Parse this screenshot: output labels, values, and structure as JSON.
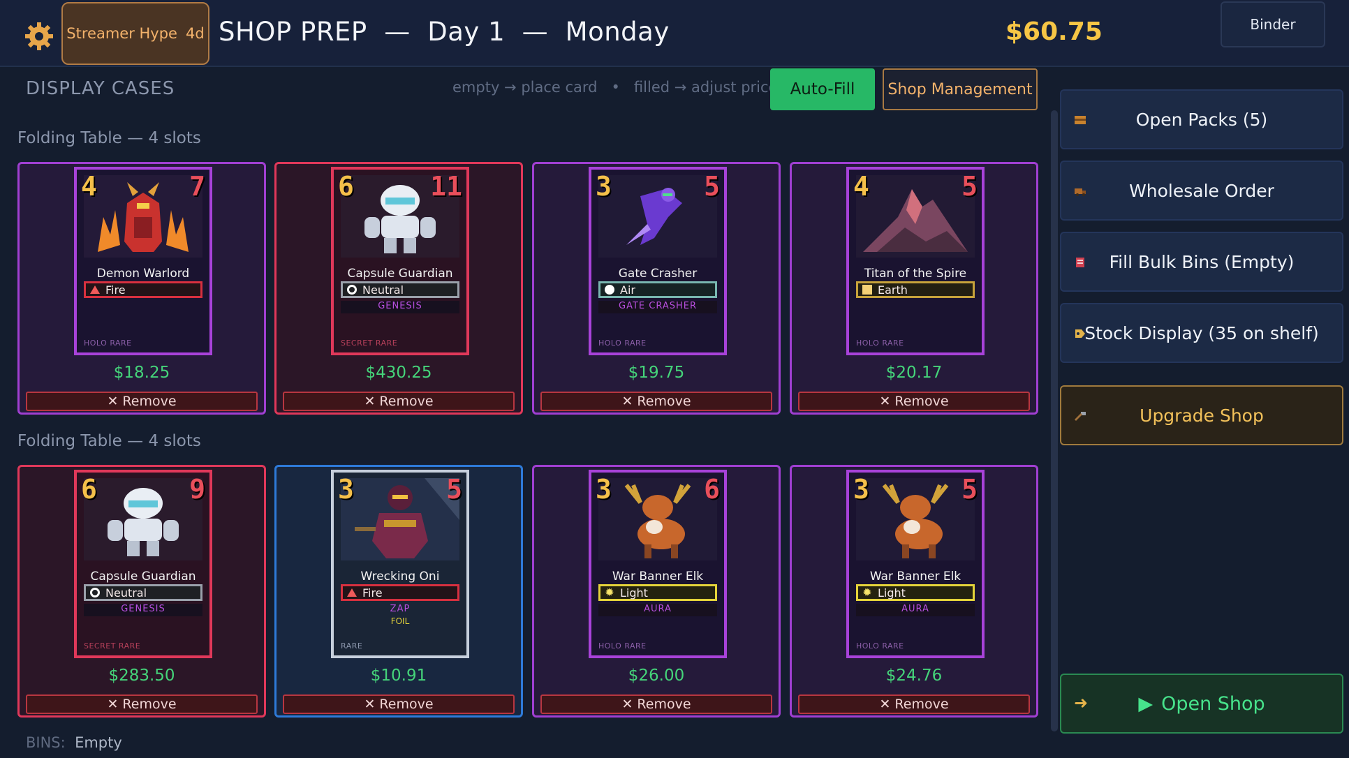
{
  "header": {
    "hype_label": "Streamer Hype",
    "hype_value": "4d",
    "title": "SHOP PREP  —  Day 1  —  Monday",
    "money": "$60.75",
    "binder_label": "Binder"
  },
  "display": {
    "heading": "DISPLAY CASES",
    "hint": "empty → place card   •   filled → adjust price",
    "autofill_label": "Auto-Fill",
    "shop_mgmt_label": "Shop Management",
    "tables": [
      {
        "label": "Folding Table — 4 slots"
      },
      {
        "label": "Folding Table — 4 slots"
      }
    ],
    "remove_label": "Remove",
    "slots": [
      {
        "cost": "4",
        "power": "7",
        "name": "Demon Warlord",
        "element": "Fire",
        "set": "",
        "foil": "",
        "rarity": "HOLO RARE",
        "price": "$18.25"
      },
      {
        "cost": "6",
        "power": "11",
        "name": "Capsule Guardian",
        "element": "Neutral",
        "set": "GENESIS",
        "foil": "",
        "rarity": "SECRET RARE",
        "price": "$430.25"
      },
      {
        "cost": "3",
        "power": "5",
        "name": "Gate Crasher",
        "element": "Air",
        "set": "GATE CRASHER",
        "foil": "",
        "rarity": "HOLO RARE",
        "price": "$19.75"
      },
      {
        "cost": "4",
        "power": "5",
        "name": "Titan of the Spire",
        "element": "Earth",
        "set": "",
        "foil": "",
        "rarity": "HOLO RARE",
        "price": "$20.17"
      },
      {
        "cost": "6",
        "power": "9",
        "name": "Capsule Guardian",
        "element": "Neutral",
        "set": "GENESIS",
        "foil": "",
        "rarity": "SECRET RARE",
        "price": "$283.50"
      },
      {
        "cost": "3",
        "power": "5",
        "name": "Wrecking Oni",
        "element": "Fire",
        "set": "ZAP",
        "foil": "FOIL",
        "rarity": "RARE",
        "price": "$10.91"
      },
      {
        "cost": "3",
        "power": "6",
        "name": "War Banner Elk",
        "element": "Light",
        "set": "AURA",
        "foil": "",
        "rarity": "HOLO RARE",
        "price": "$26.00"
      },
      {
        "cost": "3",
        "power": "5",
        "name": "War Banner Elk",
        "element": "Light",
        "set": "AURA",
        "foil": "",
        "rarity": "HOLO RARE",
        "price": "$24.76"
      }
    ],
    "bins_label": "BINS:",
    "bins_value": "Empty"
  },
  "actions": {
    "open_packs": "Open Packs  (5)",
    "wholesale": "Wholesale Order",
    "fill_bins": "Fill Bulk Bins  (Empty)",
    "stock_display": "Stock Display  (35 on shelf)",
    "upgrade": "Upgrade Shop",
    "open_shop": "Open Shop"
  },
  "colors": {
    "accent_green": "#27b866",
    "money_yellow": "#f7c645",
    "holo_border": "#a842d9",
    "secret_border": "#e0385a",
    "rare_border": "#2e7ad8"
  }
}
